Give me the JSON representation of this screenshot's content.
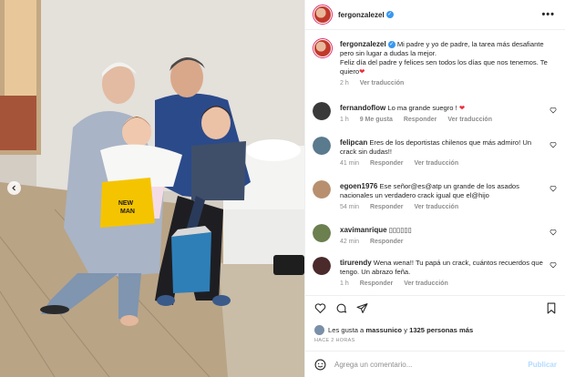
{
  "post": {
    "username": "fergonzalezel",
    "more_label": "•••"
  },
  "caption": {
    "username": "fergonzalezel",
    "line1": "Mi padre y yo de padre, la tarea más desafiante pero sin lugar a dudas la mejor.",
    "line2": "Feliz día del padre y felices sen todos los días que nos tenemos. Te quiero",
    "time": "2 h",
    "translate": "Ver traducción"
  },
  "comments": [
    {
      "username": "fernandoflow",
      "text": "Lo ma grande suegro !",
      "has_heart": true,
      "time": "1 h",
      "likes": "9 Me gusta",
      "reply": "Responder",
      "translate": "Ver traducción",
      "avatar_color": "#3a3a3a"
    },
    {
      "username": "felipcan",
      "text": "Eres de los deportistas chilenos que más admiro! Un crack sin dudas!!",
      "has_heart": false,
      "time": "41 min",
      "likes": "",
      "reply": "Responder",
      "translate": "Ver traducción",
      "avatar_color": "#5a7a8e"
    },
    {
      "username": "egoen1976",
      "text": "Ese señor@es@atp un grande de los asados nacionales un verdadero crack igual que el@hijo",
      "has_heart": false,
      "time": "54 min",
      "likes": "",
      "reply": "Responder",
      "translate": "Ver traducción",
      "avatar_color": "#b89070"
    },
    {
      "username": "xavimanrique",
      "text": "▯▯▯▯▯▯",
      "has_heart": false,
      "time": "42 min",
      "likes": "",
      "reply": "Responder",
      "translate": "",
      "avatar_color": "#6b7f4f"
    },
    {
      "username": "tirurendy",
      "text": "Wena wena!! Tu papá un crack, cuántos recuerdos que tengo. Un abrazo feña.",
      "has_heart": false,
      "time": "1 h",
      "likes": "",
      "reply": "Responder",
      "translate": "Ver traducción",
      "avatar_color": "#4a2a2a"
    }
  ],
  "actions": {
    "likes_prefix": "Les gusta a",
    "likes_user": "massunico",
    "likes_and": "y",
    "likes_count": "1325 personas más",
    "time_ago": "HACE 2 HORAS"
  },
  "comment_box": {
    "placeholder": "Agrega un comentario...",
    "publish": "Publicar"
  },
  "photo": {
    "bag_text_line1": "NEW",
    "bag_text_line2": "MAN"
  },
  "colors": {
    "verified": "#3897f0",
    "heart": "#ed2d3f",
    "publish": "#b3dbff"
  }
}
